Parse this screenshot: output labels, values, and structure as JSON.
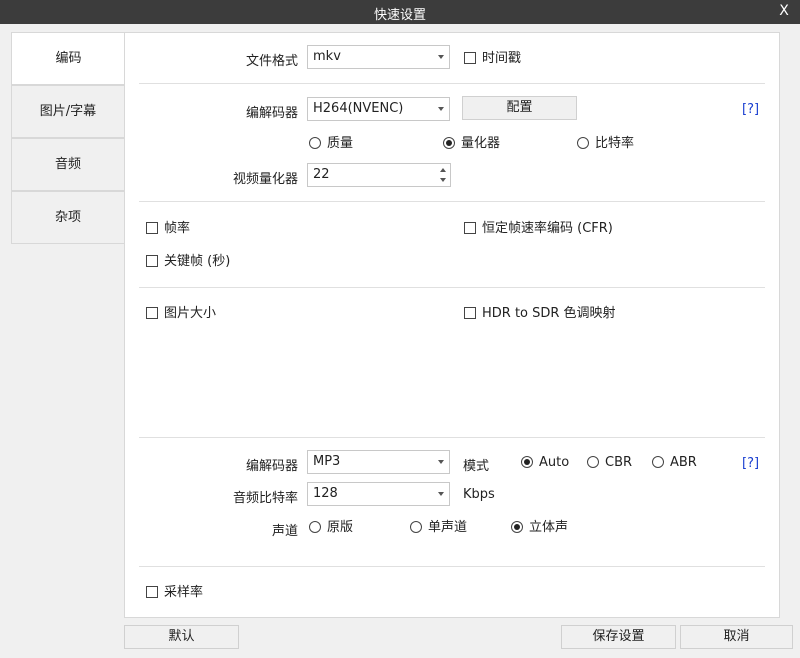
{
  "window": {
    "title": "快速设置",
    "close": "X"
  },
  "tabs": [
    {
      "label": "编码",
      "active": true
    },
    {
      "label": "图片/字幕",
      "active": false
    },
    {
      "label": "音频",
      "active": false
    },
    {
      "label": "杂项",
      "active": false
    }
  ],
  "format": {
    "label": "文件格式",
    "value": "mkv",
    "timestamp_label": "时间戳"
  },
  "video": {
    "codec_label": "编解码器",
    "codec_value": "H264(NVENC)",
    "config_button": "配置",
    "help": "[?]",
    "modes": [
      "质量",
      "量化器",
      "比特率"
    ],
    "selected_mode": 1,
    "quantizer_label": "视频量化器",
    "quantizer_value": "22"
  },
  "frame": {
    "fps_label": "帧率",
    "cfr_label": "恒定帧速率编码 (CFR)",
    "keyframe_label": "关键帧 (秒)"
  },
  "picture": {
    "size_label": "图片大小",
    "hdr_label": "HDR to SDR 色调映射"
  },
  "audio": {
    "codec_label": "编解码器",
    "codec_value": "MP3",
    "mode_label": "模式",
    "modes": [
      "Auto",
      "CBR",
      "ABR"
    ],
    "selected_mode": 0,
    "help": "[?]",
    "bitrate_label": "音频比特率",
    "bitrate_value": "128",
    "bitrate_unit": "Kbps",
    "channel_label": "声道",
    "channels": [
      "原版",
      "单声道",
      "立体声"
    ],
    "selected_channel": 2
  },
  "samplerate": {
    "label": "采样率"
  },
  "footer": {
    "default_button": "默认",
    "save_button": "保存设置",
    "cancel_button": "取消"
  }
}
